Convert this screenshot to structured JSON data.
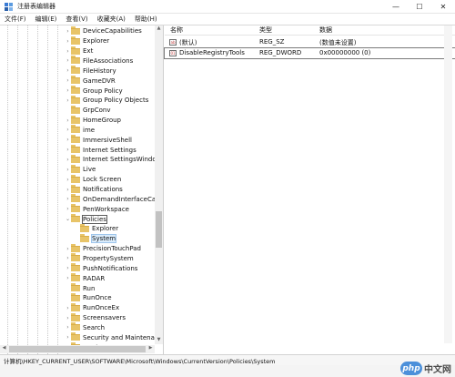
{
  "window": {
    "title": "注册表编辑器",
    "controls": {
      "minimize": "—",
      "maximize": "☐",
      "close": "✕"
    }
  },
  "menu": [
    "文件(F)",
    "编辑(E)",
    "查看(V)",
    "收藏夹(A)",
    "帮助(H)"
  ],
  "tree": {
    "items": [
      {
        "label": "DeviceCapabilities",
        "indent": 0,
        "toggle": "›",
        "open": false
      },
      {
        "label": "Explorer",
        "indent": 0,
        "toggle": "›",
        "open": false
      },
      {
        "label": "Ext",
        "indent": 0,
        "toggle": "›",
        "open": false
      },
      {
        "label": "FileAssociations",
        "indent": 0,
        "toggle": "›",
        "open": false
      },
      {
        "label": "FileHistory",
        "indent": 0,
        "toggle": "›",
        "open": false
      },
      {
        "label": "GameDVR",
        "indent": 0,
        "toggle": "›",
        "open": false
      },
      {
        "label": "Group Policy",
        "indent": 0,
        "toggle": "›",
        "open": false
      },
      {
        "label": "Group Policy Objects",
        "indent": 0,
        "toggle": "›",
        "open": false
      },
      {
        "label": "GrpConv",
        "indent": 0,
        "toggle": "",
        "open": false
      },
      {
        "label": "HomeGroup",
        "indent": 0,
        "toggle": "›",
        "open": false
      },
      {
        "label": "ime",
        "indent": 0,
        "toggle": "›",
        "open": false
      },
      {
        "label": "ImmersiveShell",
        "indent": 0,
        "toggle": "›",
        "open": false
      },
      {
        "label": "Internet Settings",
        "indent": 0,
        "toggle": "›",
        "open": false
      },
      {
        "label": "Internet SettingsWindow",
        "indent": 0,
        "toggle": "›",
        "open": false
      },
      {
        "label": "Live",
        "indent": 0,
        "toggle": "›",
        "open": false
      },
      {
        "label": "Lock Screen",
        "indent": 0,
        "toggle": "›",
        "open": false
      },
      {
        "label": "Notifications",
        "indent": 0,
        "toggle": "›",
        "open": false
      },
      {
        "label": "OnDemandInterfaceCach",
        "indent": 0,
        "toggle": "›",
        "open": false
      },
      {
        "label": "PenWorkspace",
        "indent": 0,
        "toggle": "›",
        "open": false
      },
      {
        "label": "Policies",
        "indent": 0,
        "toggle": "⌄",
        "open": true,
        "state": "focused"
      },
      {
        "label": "Explorer",
        "indent": 1,
        "toggle": "",
        "open": false
      },
      {
        "label": "System",
        "indent": 1,
        "toggle": "",
        "open": false,
        "state": "selected"
      },
      {
        "label": "PrecisionTouchPad",
        "indent": 0,
        "toggle": "›",
        "open": false
      },
      {
        "label": "PropertySystem",
        "indent": 0,
        "toggle": "›",
        "open": false
      },
      {
        "label": "PushNotifications",
        "indent": 0,
        "toggle": "›",
        "open": false
      },
      {
        "label": "RADAR",
        "indent": 0,
        "toggle": "›",
        "open": false
      },
      {
        "label": "Run",
        "indent": 0,
        "toggle": "",
        "open": false
      },
      {
        "label": "RunOnce",
        "indent": 0,
        "toggle": "",
        "open": false
      },
      {
        "label": "RunOnceEx",
        "indent": 0,
        "toggle": "›",
        "open": false
      },
      {
        "label": "Screensavers",
        "indent": 0,
        "toggle": "›",
        "open": false
      },
      {
        "label": "Search",
        "indent": 0,
        "toggle": "›",
        "open": false
      },
      {
        "label": "Security and Maintenance",
        "indent": 0,
        "toggle": "›",
        "open": false
      },
      {
        "label": "SettingSync",
        "indent": 0,
        "toggle": "›",
        "open": false
      }
    ]
  },
  "list": {
    "headers": {
      "name": "名称",
      "type": "类型",
      "data": "数据"
    },
    "rows": [
      {
        "icon": "string-value-icon",
        "icon_text": "ab",
        "name": "(默认)",
        "type": "REG_SZ",
        "data": "(数值未设置)",
        "selected": false
      },
      {
        "icon": "dword-value-icon",
        "icon_text": "01",
        "name": "DisableRegistryTools",
        "type": "REG_DWORD",
        "data": "0x00000000 (0)",
        "selected": true
      }
    ]
  },
  "status": {
    "path": "计算机\\HKEY_CURRENT_USER\\SOFTWARE\\Microsoft\\Windows\\CurrentVersion\\Policies\\System"
  },
  "watermark": {
    "badge": "php",
    "text": "中文网"
  },
  "colors": {
    "folder": "#e8c468",
    "selection": "#d9ebfb",
    "watermark_blue": "#2f7fd6"
  }
}
